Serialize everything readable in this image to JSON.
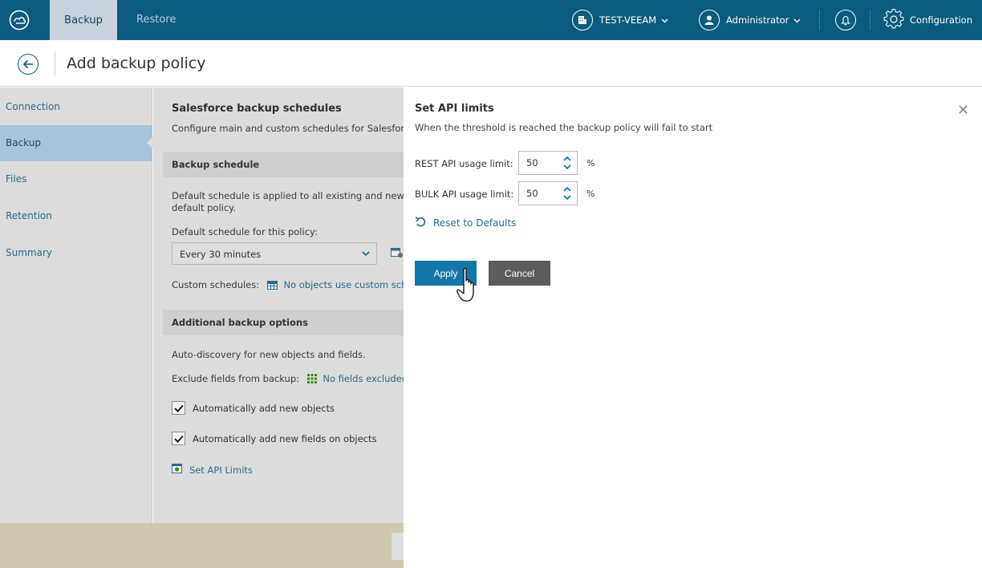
{
  "topbar": {
    "tabs": [
      {
        "label": "Backup",
        "active": true
      },
      {
        "label": "Restore",
        "active": false
      }
    ],
    "server": "TEST-VEEAM",
    "user": "Administrator",
    "configuration": "Configuration",
    "icons": {
      "logo": "cloud-logo-icon",
      "server": "building-icon",
      "user": "user-icon",
      "notifications": "bell-icon",
      "configuration": "gear-icon"
    }
  },
  "header": {
    "title": "Add backup policy"
  },
  "sidebar": {
    "items": [
      {
        "label": "Connection",
        "active": false
      },
      {
        "label": "Backup",
        "active": true
      },
      {
        "label": "Files",
        "active": false
      },
      {
        "label": "Retention",
        "active": false
      },
      {
        "label": "Summary",
        "active": false
      }
    ]
  },
  "main": {
    "title": "Salesforce backup schedules",
    "subtitle": "Configure main and custom schedules for Salesfor",
    "backup_schedule": {
      "header": "Backup schedule",
      "desc_line1": "Default schedule is applied to all existing and new",
      "desc_line2": "default policy.",
      "default_label": "Default schedule for this policy:",
      "default_value": "Every 30 minutes",
      "custom_label": "Custom schedules:",
      "custom_link": "No objects use custom sch"
    },
    "additional": {
      "header": "Additional backup options",
      "autodiscovery": "Auto-discovery for new objects and fields.",
      "exclude_label": "Exclude fields from backup:",
      "exclude_link": "No fields excluded",
      "auto_objects": "Automatically add new objects",
      "auto_fields": "Automatically add new fields on objects",
      "set_api_limits": "Set API Limits"
    }
  },
  "panel": {
    "title": "Set API limits",
    "subtitle": "When the threshold is reached the backup policy will fail to start",
    "rest_label": "REST API usage limit:",
    "rest_value": "50",
    "bulk_label": "BULK API usage limit:",
    "bulk_value": "50",
    "unit": "%",
    "reset": "Reset to Defaults",
    "apply": "Apply",
    "cancel": "Cancel"
  },
  "colors": {
    "topbar": "#0b5b80",
    "accent": "#1277a8",
    "link": "#2a6a8c",
    "cancel": "#5c5c5c",
    "dimmed": "#dcdcdc"
  }
}
